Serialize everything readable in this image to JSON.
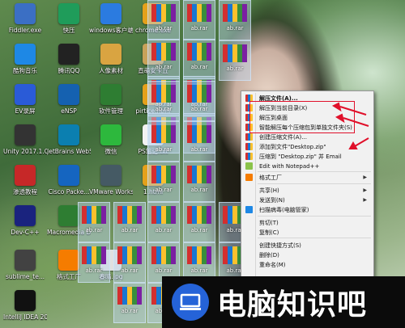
{
  "desktop": {
    "icons": [
      {
        "label": "Fiddler.exe",
        "icon": "fiddler-icon",
        "color": "#3b6fc4"
      },
      {
        "label": "快压",
        "icon": "kuaiya-icon",
        "color": "#1f9c5a"
      },
      {
        "label": "windows客户端.exe",
        "icon": "windows-client-icon",
        "color": "#2b7be0"
      },
      {
        "label": "chrome.exe",
        "icon": "chrome-icon",
        "color": "#e4a11b"
      },
      {
        "label": "酷狗音乐",
        "icon": "kugou-icon",
        "color": "#1e88e5"
      },
      {
        "label": "腾讯QQ",
        "icon": "qq-icon",
        "color": "#222222"
      },
      {
        "label": "人像素材",
        "icon": "folder-icon",
        "color": "#d9a441"
      },
      {
        "label": "直萌安卡丘",
        "icon": "folder-icon",
        "color": "#c8a25a"
      },
      {
        "label": "EV录屏",
        "icon": "ev-recorder-icon",
        "color": "#2a5bd7"
      },
      {
        "label": "eNSP",
        "icon": "ensp-icon",
        "color": "#1561b0"
      },
      {
        "label": "软件管理",
        "icon": "software-manager-icon",
        "color": "#2e7d32"
      },
      {
        "label": "pirtice.html",
        "icon": "chrome-icon",
        "color": "#e4a11b"
      },
      {
        "label": "Unity 2017.1.0...",
        "icon": "unity-icon",
        "color": "#333333"
      },
      {
        "label": "JetBrains WebStor...",
        "icon": "webstorm-icon",
        "color": "#0b7fb0"
      },
      {
        "label": "微信",
        "icon": "wechat-icon",
        "color": "#2db83d"
      },
      {
        "label": "PS笔记.txt",
        "icon": "text-file-icon",
        "color": "#f2f2f2"
      },
      {
        "label": "渗透教程",
        "icon": "tutorial-icon",
        "color": "#c62828"
      },
      {
        "label": "Cisco Packe...",
        "icon": "cisco-icon",
        "color": "#1565c0"
      },
      {
        "label": "VMware Workstati...",
        "icon": "vmware-icon",
        "color": "#455a64"
      },
      {
        "label": "1.html",
        "icon": "chrome-icon",
        "color": "#e4a11b"
      },
      {
        "label": "Dev-C++",
        "icon": "devcpp-icon",
        "color": "#1a237e"
      },
      {
        "label": "Macromedia Dreamwe...",
        "icon": "dreamweaver-icon",
        "color": "#2e7d32"
      },
      {
        "label": "sublime_te...",
        "icon": "sublime-icon",
        "color": "#424242"
      },
      {
        "label": "格式工厂",
        "icon": "format-factory-icon",
        "color": "#f57c00"
      },
      {
        "label": "春晴.jpg",
        "icon": "image-file-icon",
        "color": "#e0e0e0"
      },
      {
        "label": "IntelliJ IDEA 2019.1.3 x64",
        "icon": "intellij-icon",
        "color": "#111111"
      }
    ],
    "rar_label": "ab.rar",
    "rar_colors": [
      "#d32f2f",
      "#1976d2",
      "#fbc02d",
      "#388e3c",
      "#7b1fa2"
    ]
  },
  "context_menu": {
    "items": [
      {
        "label": "解压文件(A)...",
        "icon": "winrar-icon",
        "bold": true
      },
      {
        "label": "解压到当前目录(X)",
        "icon": "winrar-icon"
      },
      {
        "label": "解压到桌面",
        "icon": "winrar-icon"
      },
      {
        "label": "智能解压每个压缩包到单独文件夹(S)",
        "icon": "winrar-icon"
      },
      {
        "label": "创建压缩文件(A)...",
        "icon": "winrar-icon"
      },
      {
        "label": "添加到文件\"Desktop.zip\"",
        "icon": "winrar-icon"
      },
      {
        "label": "压缩到 \"Desktop.zip\" 并 Email",
        "icon": "winrar-icon"
      },
      {
        "label": "Edit with Notepad++",
        "icon": "notepad-icon"
      },
      {
        "label": "格式工厂",
        "icon": "format-factory-icon",
        "submenu": true
      },
      {
        "label": "共享(H)",
        "icon": "",
        "submenu": true
      },
      {
        "label": "发送到(N)",
        "icon": "",
        "submenu": true
      },
      {
        "label": "扫描病毒(电脑管家)",
        "icon": "shield-icon"
      },
      {
        "label": "剪切(T)",
        "icon": ""
      },
      {
        "label": "复制(C)",
        "icon": ""
      },
      {
        "label": "创建快捷方式(S)",
        "icon": ""
      },
      {
        "label": "删除(D)",
        "icon": ""
      },
      {
        "label": "重命名(M)",
        "icon": ""
      }
    ]
  },
  "banner": {
    "text": "电脑知识吧",
    "logo_color": "#2563d8"
  },
  "colors": {
    "highlight": "#e0102a"
  }
}
